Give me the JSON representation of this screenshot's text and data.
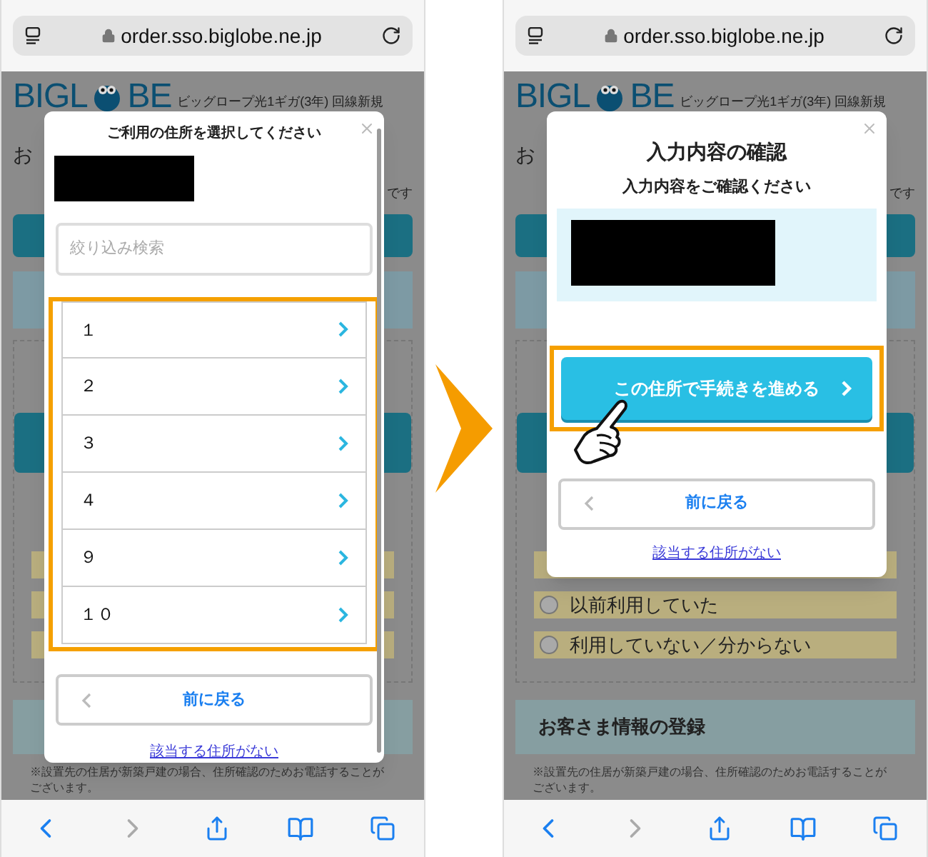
{
  "phones": [
    {
      "url": "order.sso.biglobe.ne.jp",
      "background": {
        "logo_left": "BIGL",
        "logo_right": "BE",
        "service": "ビッグロープ光1ギガ(3年) 回線新規",
        "heading_fragment": "お",
        "note_fragment": "です",
        "notice": "※設置先の住居が新築戸建の場合、住所確認のためお電話することが",
        "notice_cont": "ございます。"
      },
      "modal": {
        "kind": "address_select",
        "title": "ご利用の住所を選択してください",
        "search": {
          "placeholder": "絞り込み検索"
        },
        "addresses": [
          {
            "label": "１"
          },
          {
            "label": "２"
          },
          {
            "label": "３"
          },
          {
            "label": "４"
          },
          {
            "label": "９"
          },
          {
            "label": "１０"
          }
        ],
        "back_button": "前に戻る",
        "link": "該当する住所がない"
      }
    },
    {
      "url": "order.sso.biglobe.ne.jp",
      "background": {
        "logo_left": "BIGL",
        "logo_right": "BE",
        "service": "ビッグロープ光1ギガ(3年) 回線新規",
        "heading_fragment": "お",
        "note_fragment": "です",
        "radio_options": [
          {
            "label": "以前利用していた",
            "selected": false
          },
          {
            "label": "利用していない／分からない",
            "selected": false
          }
        ],
        "section_heading": "お客さま情報の登録",
        "notice": "※設置先の住居が新築戸建の場合、住所確認のためお電話することが",
        "notice_cont": "ございます。"
      },
      "modal": {
        "kind": "confirm",
        "title": "入力内容の確認",
        "subtitle": "入力内容をご確認ください",
        "proceed_button": "この住所で手続きを進める",
        "back_button": "前に戻る",
        "link": "該当する住所がない"
      }
    }
  ]
}
